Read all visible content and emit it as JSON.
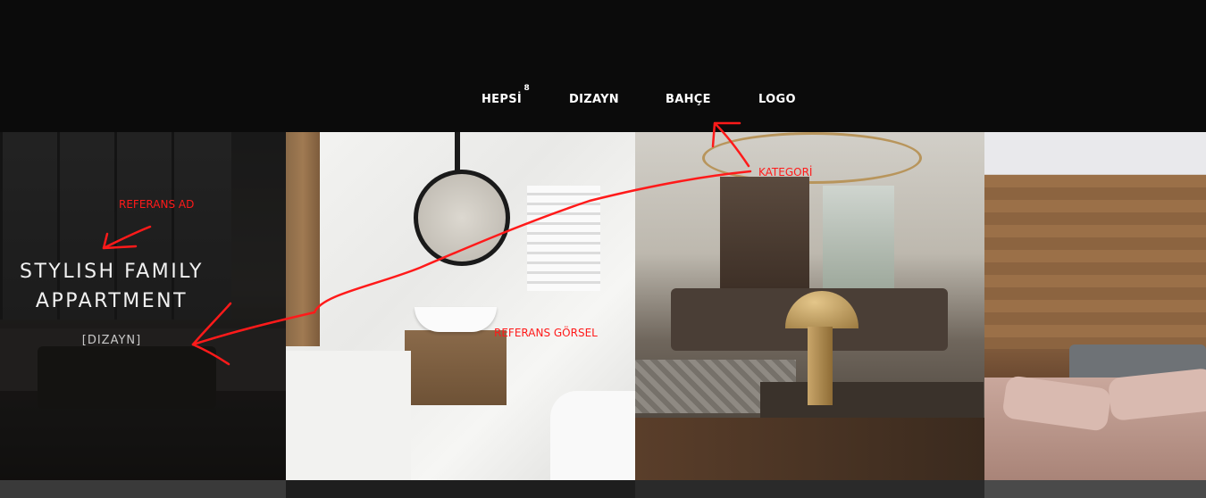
{
  "filters": {
    "items": [
      {
        "label": "HEPSİ",
        "count": "8",
        "active": true
      },
      {
        "label": "DIZAYN"
      },
      {
        "label": "BAHÇE"
      },
      {
        "label": "LOGO"
      }
    ]
  },
  "gallery": {
    "featured": {
      "title_line1": "STYLISH FAMILY",
      "title_line2": "APPARTMENT",
      "category": "[DIZAYN]"
    }
  },
  "annotations": {
    "referans_ad": "REFERANS AD",
    "referans_gorsel": "REFERANS GÖRSEL",
    "kategori": "KATEGORİ",
    "color": "#ff1a1a"
  }
}
